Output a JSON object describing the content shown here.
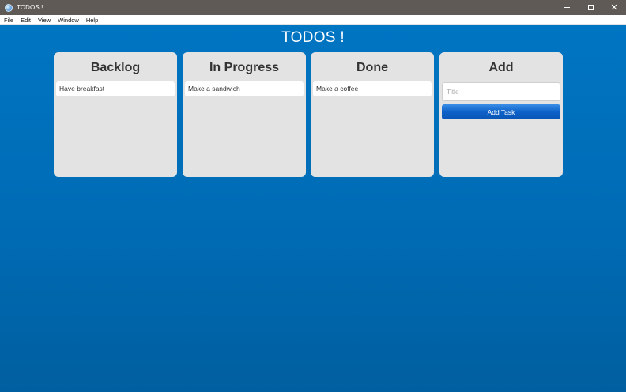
{
  "window": {
    "title": "TODOS !",
    "controls": {
      "minimize": "",
      "maximize": "",
      "close": "✕"
    }
  },
  "menu": [
    {
      "label": "File"
    },
    {
      "label": "Edit"
    },
    {
      "label": "View"
    },
    {
      "label": "Window"
    },
    {
      "label": "Help"
    }
  ],
  "app": {
    "title": "TODOS !"
  },
  "columns": {
    "backlog": {
      "heading": "Backlog",
      "tasks": [
        "Have breakfast"
      ]
    },
    "in_progress": {
      "heading": "In Progress",
      "tasks": [
        "Make a sandwich"
      ]
    },
    "done": {
      "heading": "Done",
      "tasks": [
        "Make a coffee"
      ]
    },
    "add": {
      "heading": "Add",
      "title_input": {
        "value": "",
        "placeholder": "Title"
      },
      "button_label": "Add Task"
    }
  },
  "colors": {
    "background_top": "#0075c2",
    "background_bottom": "#005f9f",
    "panel": "#e3e3e3",
    "button": "#0e62c9"
  }
}
